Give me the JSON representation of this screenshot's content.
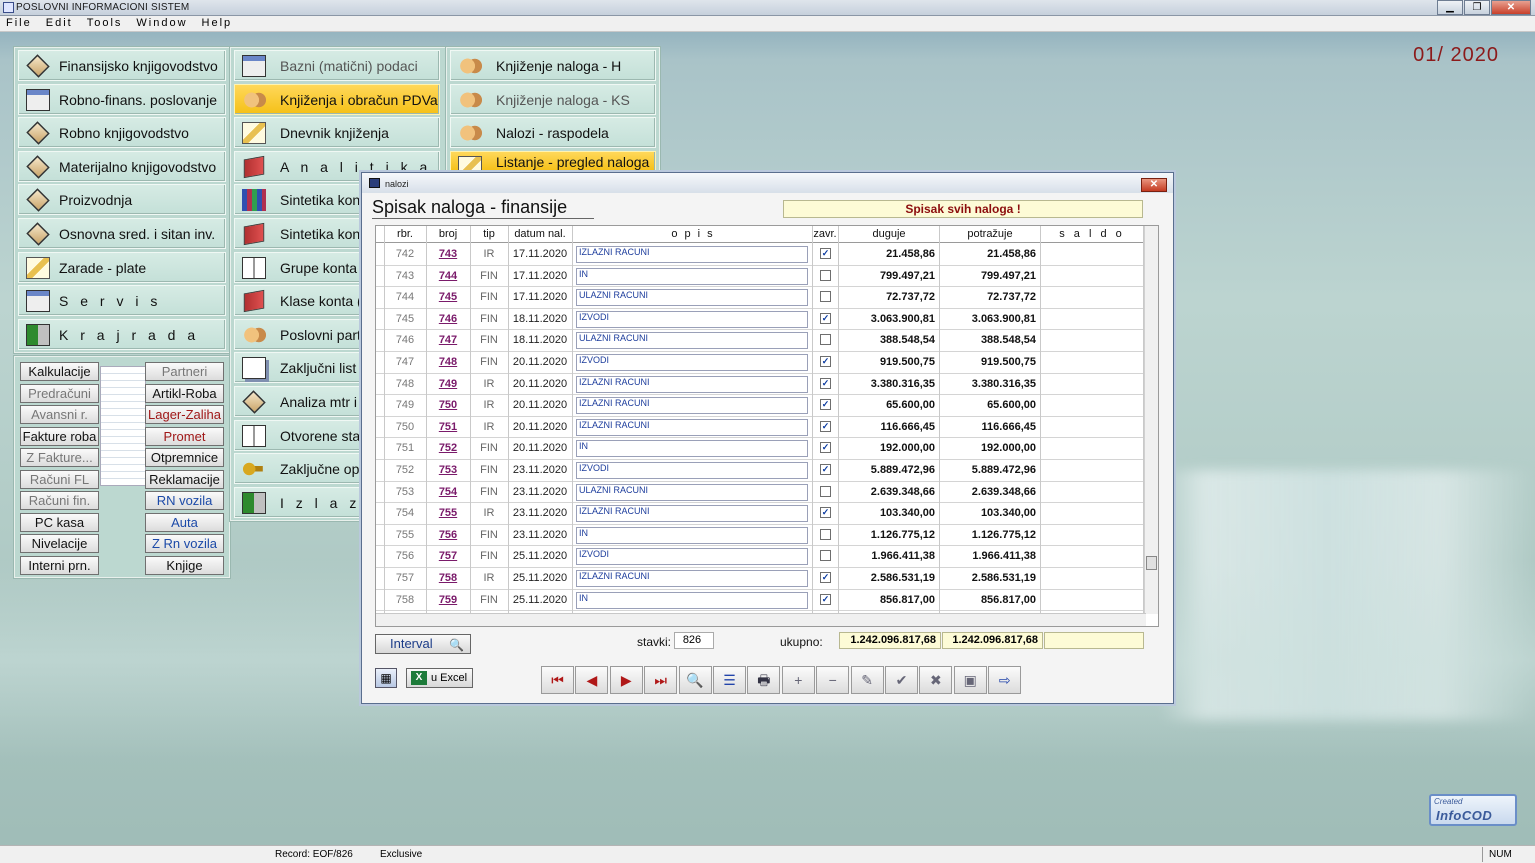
{
  "app": {
    "title": "POSLOVNI INFORMACIONI SISTEM",
    "period": "01/ 2020"
  },
  "menu": [
    "File",
    "Edit",
    "Tools",
    "Window",
    "Help"
  ],
  "col1": [
    "Finansijsko knjigovodstvo",
    "Robno-finans. poslovanje",
    "Robno knjigovodstvo",
    "Materijalno knjigovodstvo",
    "Proizvodnja",
    "Osnovna sred. i sitan inv.",
    "Zarade - plate",
    "S e r v i s",
    "K r a j  r a d a"
  ],
  "col2": [
    "Bazni (matični) podaci",
    "Knjiženja i obračun PDVa",
    "Dnevnik knjiženja",
    "A n a l i t i k a",
    "Sintetika konta",
    "Sintetika konta",
    "Grupe konta (",
    "Klase konta (",
    "Poslovni partn",
    "Zaključni list",
    "Analiza mtr i",
    "Otvorene stav",
    "Zaključne ope",
    "I z l a z"
  ],
  "col3": [
    "Knjiženje naloga - H",
    "Knjiženje naloga - KS",
    "Nalozi - raspodela",
    "Listanje - pregled naloga"
  ],
  "small_left": [
    "Kalkulacije",
    "Predračuni",
    "Avansni r.",
    "Fakture roba",
    "Z Fakture...",
    "Računi FL",
    "Računi fin.",
    "PC kasa",
    "Nivelacije",
    "Interni prn."
  ],
  "small_right": [
    "Partneri",
    "Artikl-Roba",
    "Lager-Zaliha",
    "Promet",
    "Otpremnice",
    "Reklamacije",
    "RN vozila",
    "Auta",
    "Z Rn vozila",
    "Knjige"
  ],
  "dialog": {
    "window_name": "nalozi",
    "title": "Spisak naloga - finansije",
    "badge": "Spisak svih naloga !"
  },
  "grid": {
    "headers": [
      "rbr.",
      "broj",
      "tip",
      "datum nal.",
      "o p i s",
      "zavr.",
      "duguje",
      "potražuje",
      "s a l d o"
    ],
    "rows": [
      {
        "rbr": "742",
        "broj": "743",
        "tip": "IR",
        "datum": "17.11.2020",
        "opis": "IZLAZNI RACUNI",
        "zavr": "✓",
        "duguje": "21.458,86",
        "potrazuje": "21.458,86"
      },
      {
        "rbr": "743",
        "broj": "744",
        "tip": "FIN",
        "datum": "17.11.2020",
        "opis": "IN",
        "zavr": "",
        "duguje": "799.497,21",
        "potrazuje": "799.497,21"
      },
      {
        "rbr": "744",
        "broj": "745",
        "tip": "FIN",
        "datum": "17.11.2020",
        "opis": "ULAZNI RACUNI",
        "zavr": "",
        "duguje": "72.737,72",
        "potrazuje": "72.737,72"
      },
      {
        "rbr": "745",
        "broj": "746",
        "tip": "FIN",
        "datum": "18.11.2020",
        "opis": "IZVODI",
        "zavr": "✓",
        "duguje": "3.063.900,81",
        "potrazuje": "3.063.900,81"
      },
      {
        "rbr": "746",
        "broj": "747",
        "tip": "FIN",
        "datum": "18.11.2020",
        "opis": "ULAZNI RACUNI",
        "zavr": "",
        "duguje": "388.548,54",
        "potrazuje": "388.548,54"
      },
      {
        "rbr": "747",
        "broj": "748",
        "tip": "FIN",
        "datum": "20.11.2020",
        "opis": "IZVODI",
        "zavr": "✓",
        "duguje": "919.500,75",
        "potrazuje": "919.500,75"
      },
      {
        "rbr": "748",
        "broj": "749",
        "tip": "IR",
        "datum": "20.11.2020",
        "opis": "IZLAZNI RACUNI",
        "zavr": "✓",
        "duguje": "3.380.316,35",
        "potrazuje": "3.380.316,35"
      },
      {
        "rbr": "749",
        "broj": "750",
        "tip": "IR",
        "datum": "20.11.2020",
        "opis": "IZLAZNI RACUNI",
        "zavr": "✓",
        "duguje": "65.600,00",
        "potrazuje": "65.600,00"
      },
      {
        "rbr": "750",
        "broj": "751",
        "tip": "IR",
        "datum": "20.11.2020",
        "opis": "IZLAZNI RACUNI",
        "zavr": "✓",
        "duguje": "116.666,45",
        "potrazuje": "116.666,45"
      },
      {
        "rbr": "751",
        "broj": "752",
        "tip": "FIN",
        "datum": "20.11.2020",
        "opis": "IN",
        "zavr": "✓",
        "duguje": "192.000,00",
        "potrazuje": "192.000,00"
      },
      {
        "rbr": "752",
        "broj": "753",
        "tip": "FIN",
        "datum": "23.11.2020",
        "opis": "IZVODI",
        "zavr": "✓",
        "duguje": "5.889.472,96",
        "potrazuje": "5.889.472,96"
      },
      {
        "rbr": "753",
        "broj": "754",
        "tip": "FIN",
        "datum": "23.11.2020",
        "opis": "ULAZNI RACUNI",
        "zavr": "",
        "duguje": "2.639.348,66",
        "potrazuje": "2.639.348,66"
      },
      {
        "rbr": "754",
        "broj": "755",
        "tip": "IR",
        "datum": "23.11.2020",
        "opis": "IZLAZNI RACUNI",
        "zavr": "✓",
        "duguje": "103.340,00",
        "potrazuje": "103.340,00"
      },
      {
        "rbr": "755",
        "broj": "756",
        "tip": "FIN",
        "datum": "23.11.2020",
        "opis": "IN",
        "zavr": "",
        "duguje": "1.126.775,12",
        "potrazuje": "1.126.775,12"
      },
      {
        "rbr": "756",
        "broj": "757",
        "tip": "FIN",
        "datum": "25.11.2020",
        "opis": "IZVODI",
        "zavr": "",
        "duguje": "1.966.411,38",
        "potrazuje": "1.966.411,38"
      },
      {
        "rbr": "757",
        "broj": "758",
        "tip": "IR",
        "datum": "25.11.2020",
        "opis": "IZLAZNI RACUNI",
        "zavr": "✓",
        "duguje": "2.586.531,19",
        "potrazuje": "2.586.531,19"
      },
      {
        "rbr": "758",
        "broj": "759",
        "tip": "FIN",
        "datum": "25.11.2020",
        "opis": "IN",
        "zavr": "✓",
        "duguje": "856.817,00",
        "potrazuje": "856.817,00"
      }
    ]
  },
  "footer": {
    "interval": "Interval",
    "stavki_label": "stavki:",
    "stavki": "826",
    "ukupno_label": "ukupno:",
    "ukupno_duguje": "1.242.096.817,68",
    "ukupno_potrazuje": "1.242.096.817,68",
    "excel": "u Excel"
  },
  "toolbar": [
    "⏮",
    "◀",
    "▶",
    "⏭",
    "🔍",
    "☰",
    "🖶",
    "+",
    "−",
    "✎",
    "✔",
    "✖",
    "▣",
    "⇨"
  ],
  "status": {
    "record": "Record: EOF/826",
    "mode": "Exclusive",
    "num": "NUM"
  },
  "logo": {
    "created": "Created",
    "name": "InfoCOD"
  }
}
